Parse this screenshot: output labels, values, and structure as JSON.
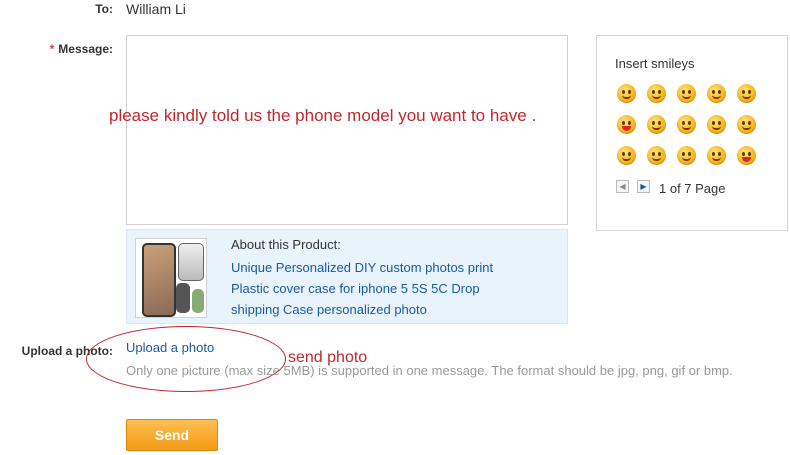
{
  "to": {
    "label": "To:",
    "value": "William Li"
  },
  "message": {
    "required_mark": "*",
    "label": "Message:",
    "text": "please kindly told us the phone model you want to have ."
  },
  "smileys": {
    "title": "Insert smileys",
    "icons": [
      "smile-icon",
      "wink-tongue-icon",
      "grin-icon",
      "laugh-icon",
      "surprised-icon",
      "shout-icon",
      "cry-icon",
      "blush-icon",
      "happy-cry-icon",
      "sleepy-icon",
      "sick-icon",
      "cool-icon",
      "angry-icon",
      "shocked-icon",
      "love-icon"
    ],
    "pager_text": "1 of 7 Page",
    "prev_glyph": "◀",
    "next_glyph": "▶"
  },
  "product": {
    "about_label": "About this Product:",
    "title_lines": [
      "Unique Personalized DIY custom photos print",
      "Plastic cover case for iphone 5 5S 5C Drop",
      "shipping Case personalized photo"
    ]
  },
  "upload": {
    "label": "Upload a photo:",
    "link_text": "Upload a photo",
    "hint": "Only one picture (max size 5MB) is supported in one message. The format should be jpg, png, gif or bmp.",
    "annotation": "send photo"
  },
  "send_button": {
    "label": "Send",
    "color": "#f39b14"
  }
}
